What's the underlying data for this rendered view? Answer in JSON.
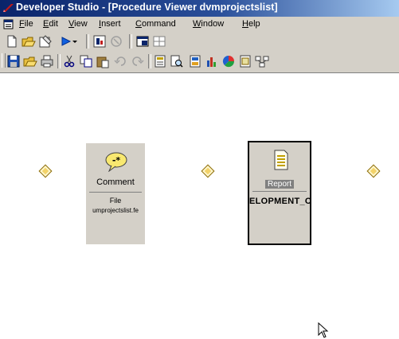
{
  "window": {
    "title": "Developer Studio - [Procedure Viewer dvmprojectslist]"
  },
  "menu": [
    {
      "pre": "",
      "acc": "F",
      "post": "ile"
    },
    {
      "pre": "",
      "acc": "E",
      "post": "dit"
    },
    {
      "pre": "",
      "acc": "V",
      "post": "iew"
    },
    {
      "pre": "",
      "acc": "I",
      "post": "nsert"
    },
    {
      "pre": "",
      "acc": "C",
      "post": "ommand"
    },
    {
      "pre": "",
      "acc": "W",
      "post": "indow"
    },
    {
      "pre": "",
      "acc": "H",
      "post": "elp"
    }
  ],
  "toolbar1": [
    "new-icon",
    "open-icon",
    "properties-icon",
    "run-icon",
    "run-dropdown-icon",
    "procedure-icon",
    "disabled-icon",
    "window-icon",
    "layout-icon"
  ],
  "toolbar2": [
    "save-icon",
    "open-folder-icon",
    "print-icon",
    "cut-icon",
    "copy-icon",
    "paste-icon",
    "undo-icon",
    "redo-icon",
    "define-icon",
    "find-icon",
    "report-tool-icon",
    "graph-tool-icon",
    "chart-tool-icon",
    "text-tool-icon",
    "join-tool-icon"
  ],
  "flow": {
    "comment_node": {
      "icon": "comment-icon",
      "label": "Comment",
      "file_label": "File",
      "file_name": "umprojectslist.fe"
    },
    "report_node": {
      "icon": "report-icon",
      "type_label": "Report",
      "name": "ELOPMENT_C"
    }
  },
  "colors": {
    "title_gradient_start": "#0a246a",
    "title_gradient_end": "#a6caf0",
    "chrome": "#d4d0c8",
    "connector": "#f3d36a"
  }
}
